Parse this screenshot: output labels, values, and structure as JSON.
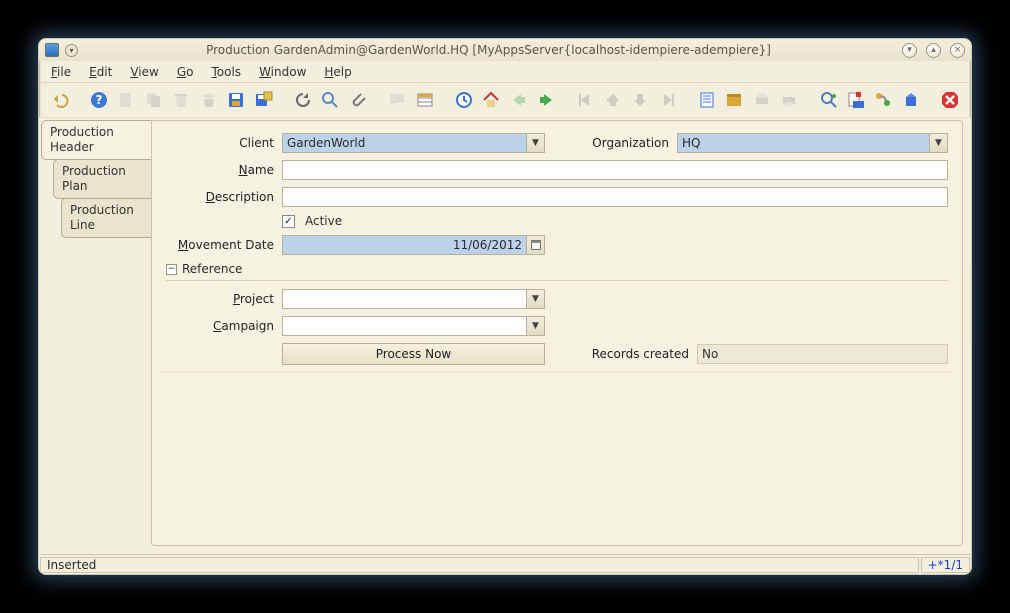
{
  "window_title": "Production  GardenAdmin@GardenWorld.HQ [MyAppsServer{localhost-idempiere-adempiere}]",
  "menu": {
    "file": "File",
    "edit": "Edit",
    "view": "View",
    "go": "Go",
    "tools": "Tools",
    "window": "Window",
    "help": "Help"
  },
  "tabs": {
    "header": "Production Header",
    "plan": "Production Plan",
    "line": "Production Line"
  },
  "labels": {
    "client": "Client",
    "organization": "Organization",
    "name": "Name",
    "description": "Description",
    "active": "Active",
    "movement_date": "Movement Date",
    "reference": "Reference",
    "project": "Project",
    "campaign": "Campaign",
    "process_now": "Process Now",
    "records_created": "Records created"
  },
  "values": {
    "client": "GardenWorld",
    "organization": "HQ",
    "name": "",
    "description": "",
    "active_checked": true,
    "movement_date": "11/06/2012",
    "project": "",
    "campaign": "",
    "records_created": "No"
  },
  "status": {
    "message": "Inserted",
    "pager": "+*1/1"
  },
  "win_controls": {
    "menu": "▾",
    "min": "▾",
    "max": "▴",
    "close": "×"
  },
  "toolbar": {
    "undo": "undo",
    "help": "help",
    "new": "new",
    "copy": "copy",
    "delete": "delete",
    "delete_sel": "delete-selection",
    "save": "save",
    "save_create": "save-create",
    "refresh": "refresh",
    "find": "find",
    "attach": "attachment",
    "chat": "chat",
    "grid": "grid-toggle",
    "history": "history",
    "home": "home",
    "back": "back",
    "forward": "forward",
    "first": "first",
    "prev": "previous",
    "next": "next",
    "last": "last",
    "report": "report",
    "archive": "archive",
    "print_prev": "print-preview",
    "print": "print",
    "zoom": "zoom-across",
    "req": "active-requests",
    "workflow": "workflow",
    "product": "product-info",
    "close": "close"
  }
}
